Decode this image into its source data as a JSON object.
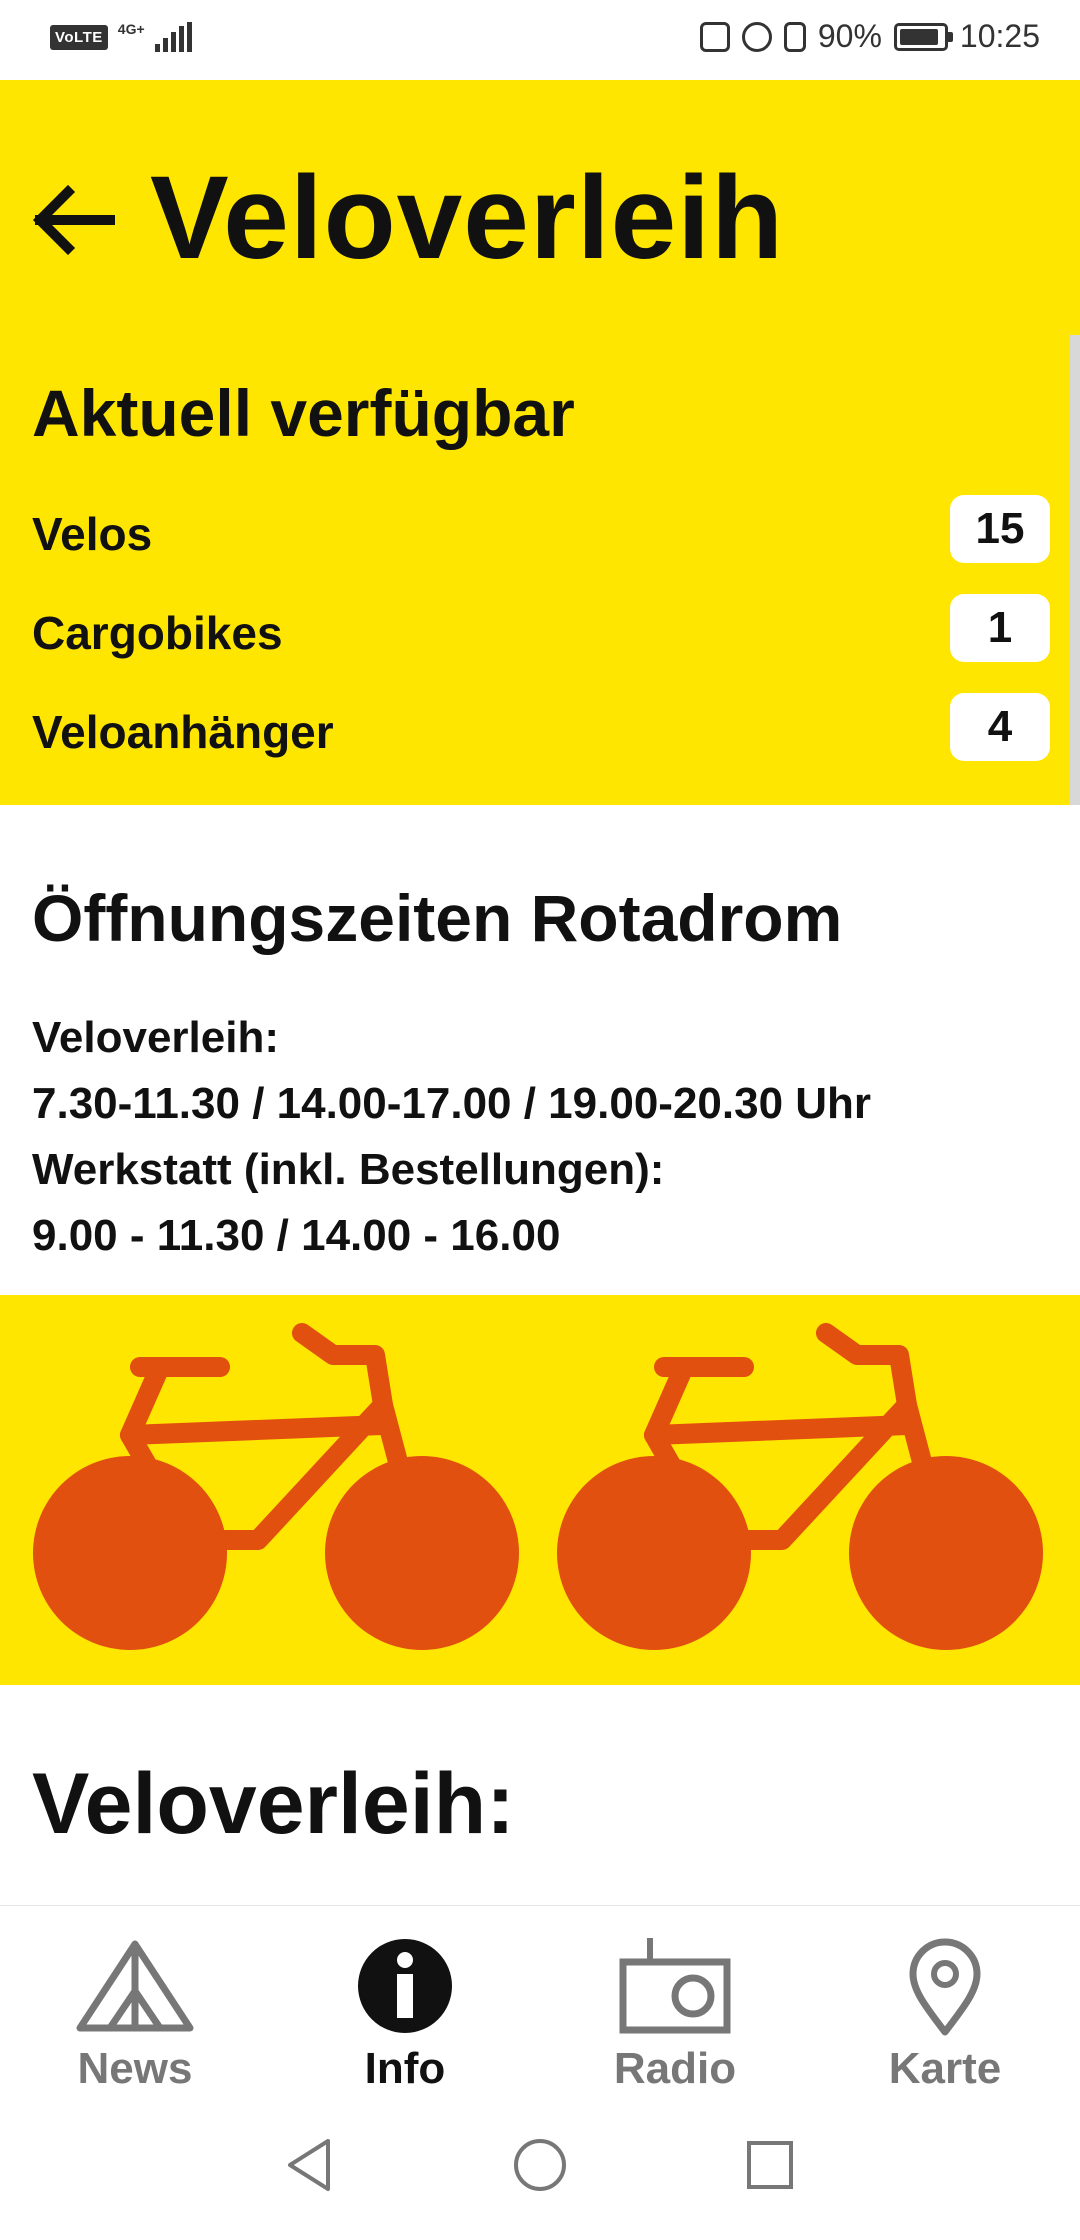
{
  "status_bar": {
    "volte": "VoLTE",
    "network": "4G+",
    "battery_percent": "90%",
    "battery_level": 0.9,
    "time": "10:25"
  },
  "header": {
    "title": "Veloverleih",
    "back_icon": "arrow-left-icon"
  },
  "availability": {
    "title": "Aktuell verfügbar",
    "rows": [
      {
        "label": "Velos",
        "count": "15"
      },
      {
        "label": "Cargobikes",
        "count": "1"
      },
      {
        "label": "Veloanhänger",
        "count": "4"
      }
    ]
  },
  "hours": {
    "title": "Öffnungszeiten Rotadrom",
    "lines": [
      "Veloverleih:",
      "7.30-11.30 / 14.00-17.00 / 19.00-20.30 Uhr",
      "Werkstatt (inkl. Bestellungen):",
      "9.00 - 11.30 / 14.00 - 16.00"
    ]
  },
  "colors": {
    "accent_yellow": "#ffe600",
    "bike_orange": "#e2500f"
  },
  "section2": {
    "title": "Veloverleih:"
  },
  "nav": {
    "items": [
      {
        "label": "News",
        "icon": "tent-icon"
      },
      {
        "label": "Info",
        "icon": "info-icon"
      },
      {
        "label": "Radio",
        "icon": "radio-icon"
      },
      {
        "label": "Karte",
        "icon": "map-pin-icon"
      }
    ],
    "active": "Info"
  },
  "system_nav": {
    "icons": [
      "back-triangle-icon",
      "home-circle-icon",
      "recents-square-icon"
    ]
  }
}
